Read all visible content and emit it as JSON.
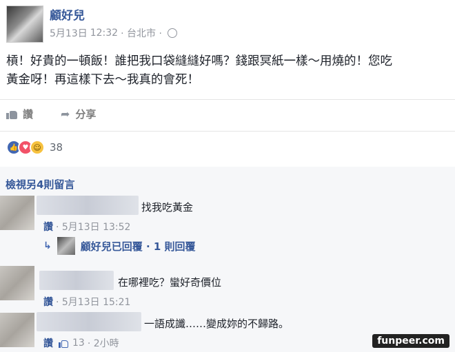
{
  "post": {
    "author": "顧好兒",
    "date": "5月13日",
    "time": "12:32",
    "location": "· 台北市 ·",
    "body_line1": "槓！好貴的一頓飯！誰把我口袋縫縫好嗎？錢跟冥紙一樣～用燒的！您吃",
    "body_line2": "黃金呀！再這樣下去～我真的會死！",
    "like_label": "讚",
    "share_label": "分享",
    "reaction_count": "38",
    "colors": {
      "link": "#365899",
      "accent": "#4267b2",
      "meta": "#90949c"
    }
  },
  "comments_section": {
    "view_more": "檢視另4則留言",
    "comments": [
      {
        "text": "找我吃黃金",
        "like_label": "讚",
        "meta": "· 5月13日 13:52"
      },
      {
        "text": "在哪裡吃？蠻好奇價位",
        "like_label": "讚",
        "meta": "· 5月13日 15:21"
      },
      {
        "text": "一語成讖……變成妳的不歸路。",
        "like_label": "讚",
        "likes": "13",
        "meta": "· 2小時"
      }
    ],
    "reply": {
      "text": "顧好兒已回覆 · 1 則回覆"
    }
  },
  "watermark": "funpeer.com",
  "icons": [
    "globe-icon",
    "like-icon",
    "share-icon",
    "reaction-like-icon",
    "reaction-love-icon",
    "reaction-haha-icon",
    "reply-arrow-icon",
    "thumb-icon"
  ]
}
